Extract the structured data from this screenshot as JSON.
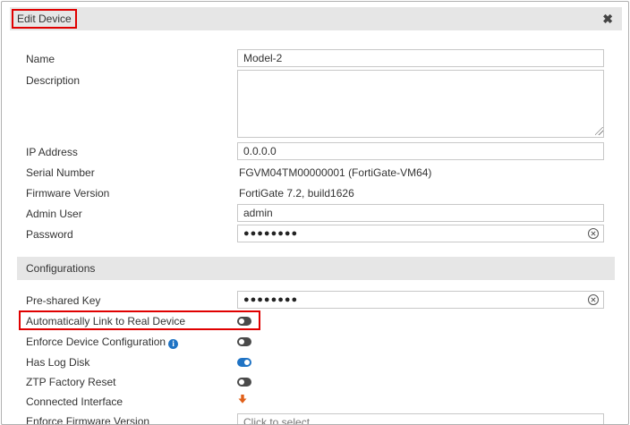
{
  "dialog": {
    "title": "Edit Device",
    "close_glyph": "✖"
  },
  "fields": {
    "name": {
      "label": "Name",
      "value": "Model-2"
    },
    "description": {
      "label": "Description",
      "value": ""
    },
    "ip_address": {
      "label": "IP Address",
      "value": "0.0.0.0"
    },
    "serial_number": {
      "label": "Serial Number",
      "value": "FGVM04TM00000001 (FortiGate-VM64)"
    },
    "firmware_version": {
      "label": "Firmware Version",
      "value": "FortiGate 7.2, build1626"
    },
    "admin_user": {
      "label": "Admin User",
      "value": "admin"
    },
    "password": {
      "label": "Password",
      "masked": "●●●●●●●●"
    }
  },
  "configurations": {
    "header": "Configurations",
    "pre_shared_key": {
      "label": "Pre-shared Key",
      "masked": "●●●●●●●●"
    },
    "auto_link": {
      "label": "Automatically Link to Real Device",
      "enabled": false
    },
    "enforce_config": {
      "label": "Enforce Device Configuration",
      "enabled": false
    },
    "has_log_disk": {
      "label": "Has Log Disk",
      "enabled": true
    },
    "ztp_reset": {
      "label": "ZTP Factory Reset",
      "enabled": false
    },
    "connected_interface": {
      "label": "Connected Interface",
      "icon": "arrow-down-icon"
    },
    "enforce_firmware": {
      "label": "Enforce Firmware Version",
      "value": "Click to select"
    }
  },
  "colors": {
    "highlight": "#e00000",
    "toggle_on": "#1f73c4",
    "toggle_off": "#4a4a4a",
    "arrow": "#e0601a"
  }
}
